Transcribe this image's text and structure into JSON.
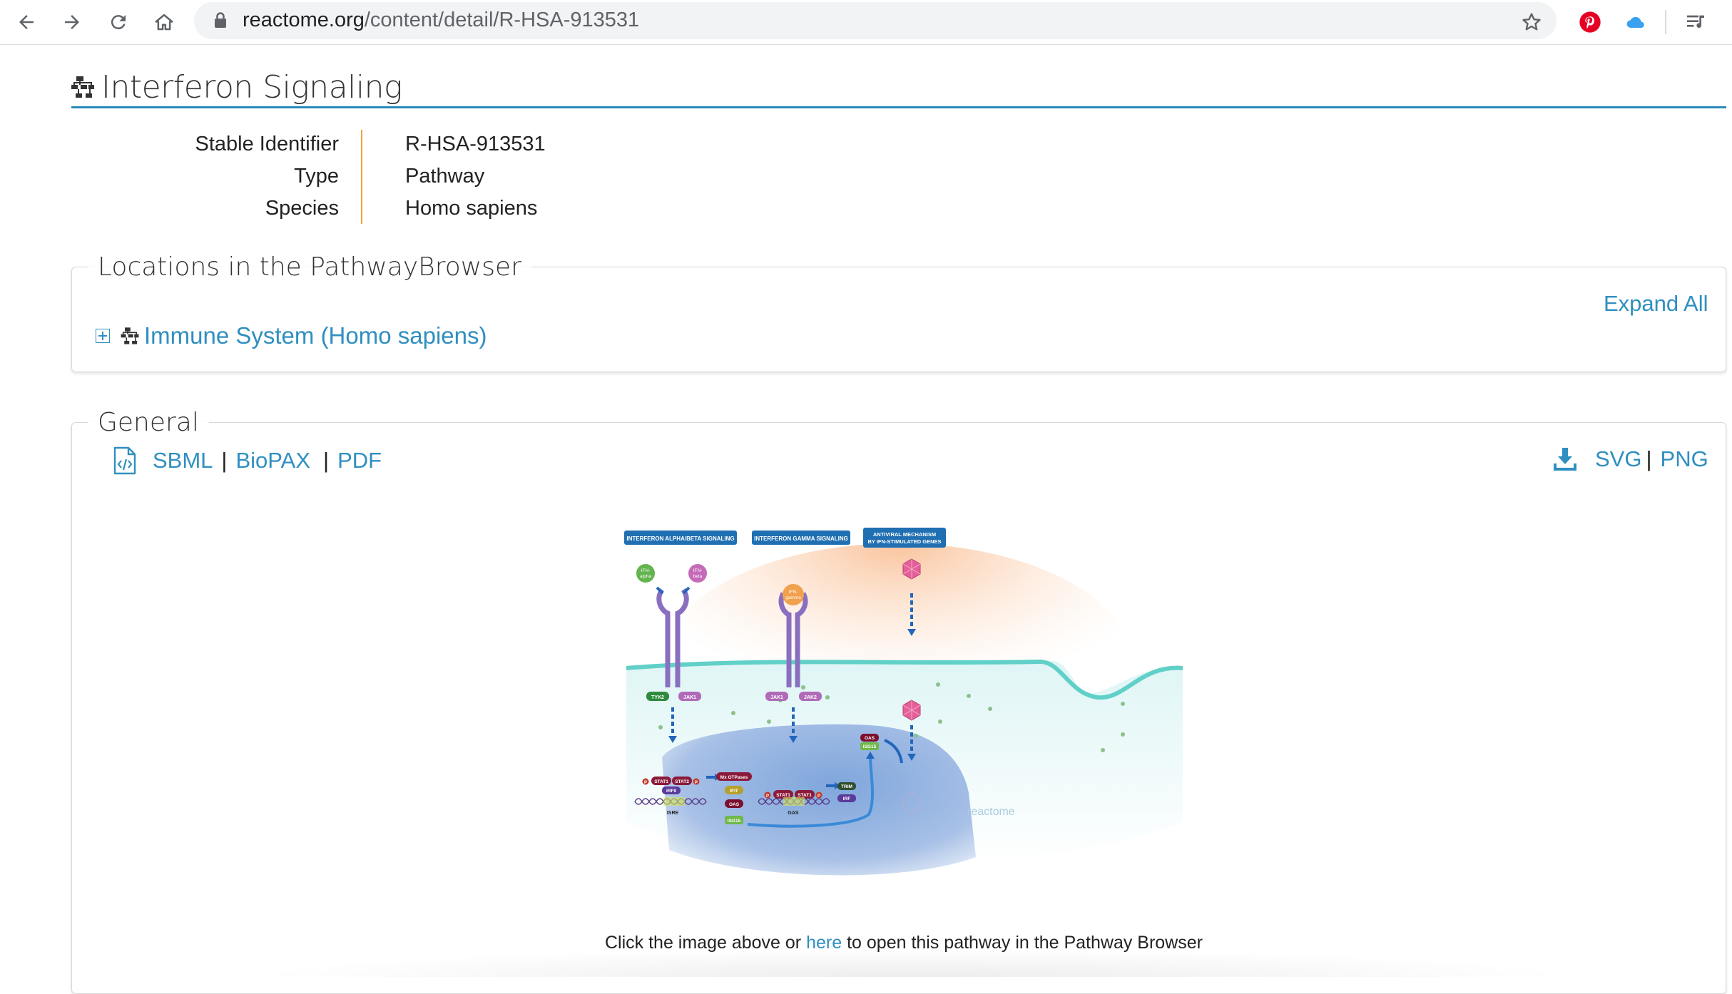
{
  "browser": {
    "url_domain": "reactome.org",
    "url_path": "/content/detail/R-HSA-913531",
    "icons": [
      "back-arrow-icon",
      "forward-arrow-icon",
      "reload-icon",
      "home-icon",
      "lock-icon",
      "star-icon",
      "pinterest-icon",
      "cloud-icon",
      "reading-list-icon"
    ]
  },
  "page": {
    "title": "Interferon Signaling",
    "meta": [
      {
        "key": "Stable Identifier",
        "value": "R-HSA-913531"
      },
      {
        "key": "Type",
        "value": "Pathway"
      },
      {
        "key": "Species",
        "value": "Homo sapiens"
      }
    ]
  },
  "locations": {
    "legend": "Locations in the PathwayBrowser",
    "expand_all": "Expand All",
    "tree_item": "Immune System (Homo sapiens)"
  },
  "general": {
    "legend": "General",
    "left_downloads": [
      "SBML",
      "BioPAX",
      "PDF"
    ],
    "right_downloads": [
      "SVG",
      "PNG"
    ],
    "separator": "|"
  },
  "diagram": {
    "headers": [
      "INTERFERON ALPHA/BETA SIGNALING",
      "INTERFERON GAMMA SIGNALING",
      "ANTIVIRAL MECHANISM",
      "BY IFN-STIMULATED GENES"
    ],
    "ligands": [
      "IFN-",
      "alpha",
      "IFN-",
      "beta",
      "IFN-",
      "gamma"
    ],
    "kinases": [
      "TYK2",
      "JAK1",
      "JAK1",
      "JAK2"
    ],
    "stat_left": [
      "STAT1",
      "STAT2",
      "IRF9"
    ],
    "stat_right": [
      "STAT1",
      "STAT1"
    ],
    "phospho": "P",
    "elements": [
      "ISRE",
      "GAS"
    ],
    "isgs": [
      "Mx GTPases",
      "IFIT",
      "OAS",
      "ISG15"
    ],
    "right_genes": [
      "TRIM",
      "IRF"
    ],
    "cyto": [
      "OAS",
      "ISG15"
    ],
    "watermark": "reactome",
    "colors": {
      "header": "#1f6fb2",
      "membrane": "#60d0c8",
      "nucleus": "#5a88c8",
      "ligand_alpha": "#63b34e",
      "ligand_beta": "#c56bb8",
      "ligand_gamma": "#f1a04c",
      "virus": "#e5609a",
      "arrow": "#2266bb"
    }
  },
  "caption": {
    "before": "Click the image above or ",
    "link": "here",
    "after": " to open this pathway in the Pathway Browser"
  }
}
